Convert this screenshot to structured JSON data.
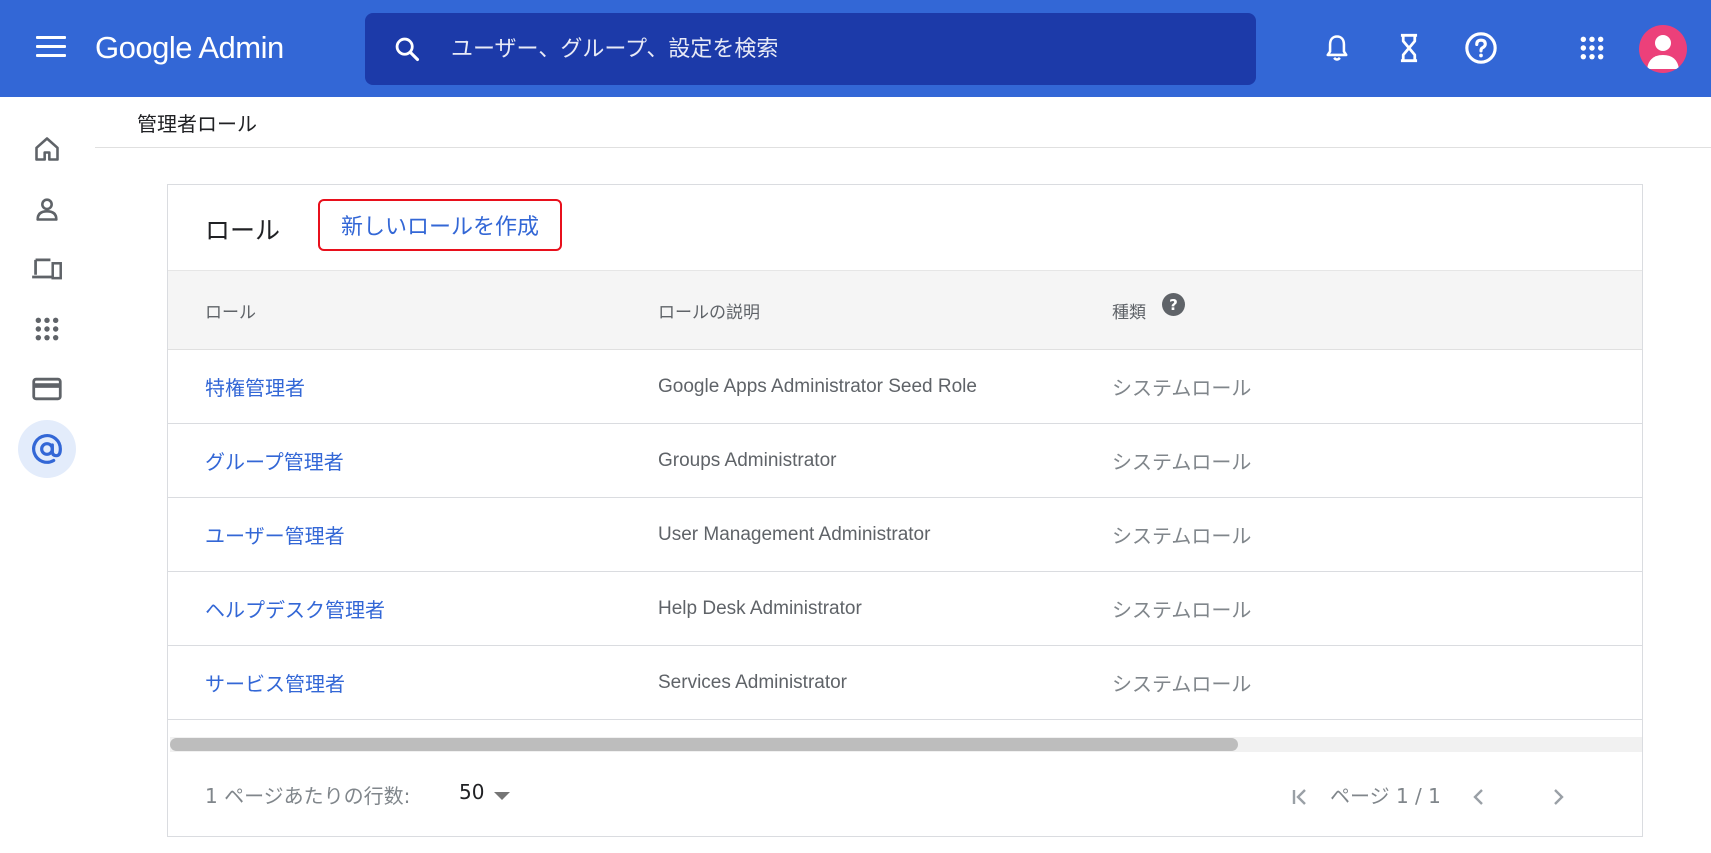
{
  "header": {
    "menu_icon": "hamburger-menu-icon",
    "brand": "Google Admin",
    "search_placeholder": "ユーザー、グループ、設定を検索",
    "icons": [
      "search-icon",
      "bell-icon",
      "hourglass-icon",
      "help-icon",
      "apps-grid-icon",
      "account-avatar-icon"
    ],
    "color": "#3367d6",
    "search_bg": "#1c3aa9",
    "avatar_color": "#ec407a"
  },
  "sidebar": {
    "items": [
      {
        "icon": "home-icon",
        "active": false
      },
      {
        "icon": "user-icon",
        "active": false
      },
      {
        "icon": "devices-icon",
        "active": false
      },
      {
        "icon": "apps-icon",
        "active": false
      },
      {
        "icon": "billing-card-icon",
        "active": false
      },
      {
        "icon": "at-sign-icon",
        "active": true
      }
    ]
  },
  "breadcrumb": "管理者ロール",
  "card": {
    "title": "ロール",
    "create_button": "新しいロールを作成",
    "columns": {
      "role": "ロール",
      "description": "ロールの説明",
      "type": "種類"
    },
    "rows": [
      {
        "name": "特権管理者",
        "description": "Google Apps Administrator Seed Role",
        "type": "システムロール"
      },
      {
        "name": "グループ管理者",
        "description": "Groups Administrator",
        "type": "システムロール"
      },
      {
        "name": "ユーザー管理者",
        "description": "User Management Administrator",
        "type": "システムロール"
      },
      {
        "name": "ヘルプデスク管理者",
        "description": "Help Desk Administrator",
        "type": "システムロール"
      },
      {
        "name": "サービス管理者",
        "description": "Services Administrator",
        "type": "システムロール"
      }
    ],
    "footer": {
      "rows_per_page_label": "1 ページあたりの行数:",
      "rows_per_page_value": "50",
      "page_info": "ページ 1 / 1"
    }
  },
  "accent_colors": {
    "link": "#3367d6",
    "highlight_border": "#e8101c"
  }
}
